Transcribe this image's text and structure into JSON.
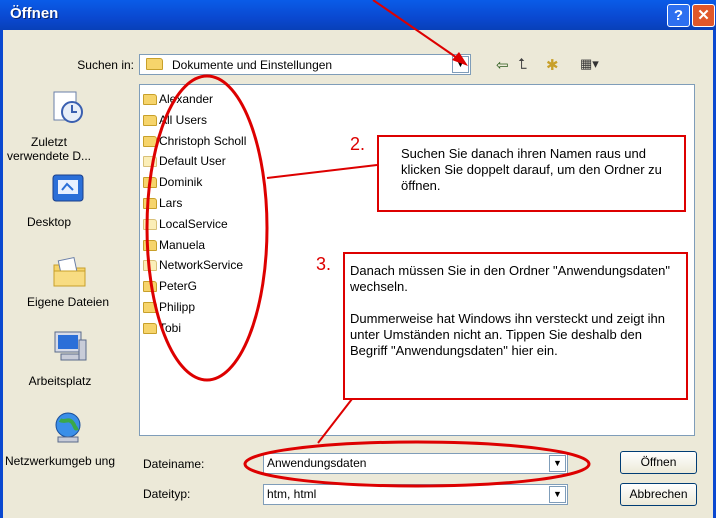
{
  "window": {
    "title": "Öffnen",
    "help_label": "?",
    "close_label": "✕"
  },
  "lookin": {
    "label": "Suchen in:",
    "value": "Dokumente und Einstellungen"
  },
  "toolbar": {
    "back_icon": "⇦",
    "up_icon": "⮤",
    "new_folder_icon": "✱",
    "view_icon": "▦▾"
  },
  "places": [
    {
      "label": "Zuletzt verwendete D...",
      "icon": "recent-documents-icon"
    },
    {
      "label": "Desktop",
      "icon": "desktop-icon"
    },
    {
      "label": "Eigene Dateien",
      "icon": "my-documents-icon"
    },
    {
      "label": "Arbeitsplatz",
      "icon": "my-computer-icon"
    },
    {
      "label": "Netzwerkumgeb ung",
      "icon": "network-icon"
    }
  ],
  "files": [
    {
      "name": "Alexander",
      "pale": false
    },
    {
      "name": "All Users",
      "pale": false
    },
    {
      "name": "Christoph Scholl",
      "pale": false
    },
    {
      "name": "Default User",
      "pale": true
    },
    {
      "name": "Dominik",
      "pale": false
    },
    {
      "name": "Lars",
      "pale": false
    },
    {
      "name": "LocalService",
      "pale": true
    },
    {
      "name": "Manuela",
      "pale": false
    },
    {
      "name": "NetworkService",
      "pale": true
    },
    {
      "name": "PeterG",
      "pale": false
    },
    {
      "name": "Philipp",
      "pale": false
    },
    {
      "name": "Tobi",
      "pale": false
    }
  ],
  "filename": {
    "label": "Dateiname:",
    "value": "Anwendungsdaten"
  },
  "filetype": {
    "label": "Dateityp:",
    "value": "htm, html"
  },
  "buttons": {
    "open": "Öffnen",
    "cancel": "Abbrechen"
  },
  "annotations": {
    "step2_number": "2.",
    "step2_text": "Suchen Sie danach ihren Namen raus und klicken Sie doppelt darauf, um den Ordner zu öffnen.",
    "step3_number": "3.",
    "step3_text_1": "Danach müssen Sie in den Ordner \"Anwendungsdaten\" wechseln.",
    "step3_text_2": "Dummerweise hat Windows ihn versteckt und zeigt ihn unter Umständen nicht an. Tippen Sie deshalb den Begriff \"Anwendungsdaten\" hier ein.",
    "color": "#dd0000"
  }
}
